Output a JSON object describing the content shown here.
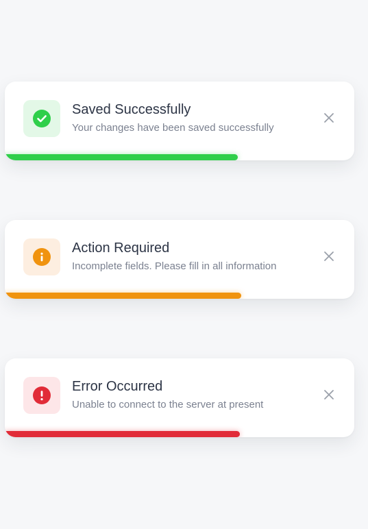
{
  "toasts": [
    {
      "type": "success",
      "title": "Saved Successfully",
      "message": "Your changes have been saved successfully",
      "icon": "check-circle-icon",
      "accent": "#2fcf4a",
      "icon_bg": "#e3f8e7",
      "progress": 0.667
    },
    {
      "type": "warning",
      "title": "Action Required",
      "message": "Incomplete fields. Please fill in all information",
      "icon": "info-circle-icon",
      "accent": "#f0930f",
      "icon_bg": "#fdeee0",
      "progress": 0.676
    },
    {
      "type": "error",
      "title": "Error Occurred",
      "message": "Unable to connect to the server at present",
      "icon": "exclamation-circle-icon",
      "accent": "#e12c38",
      "icon_bg": "#fde6e8",
      "progress": 0.672
    }
  ],
  "close_icon": "close-icon",
  "close_color": "#9aa0aa"
}
